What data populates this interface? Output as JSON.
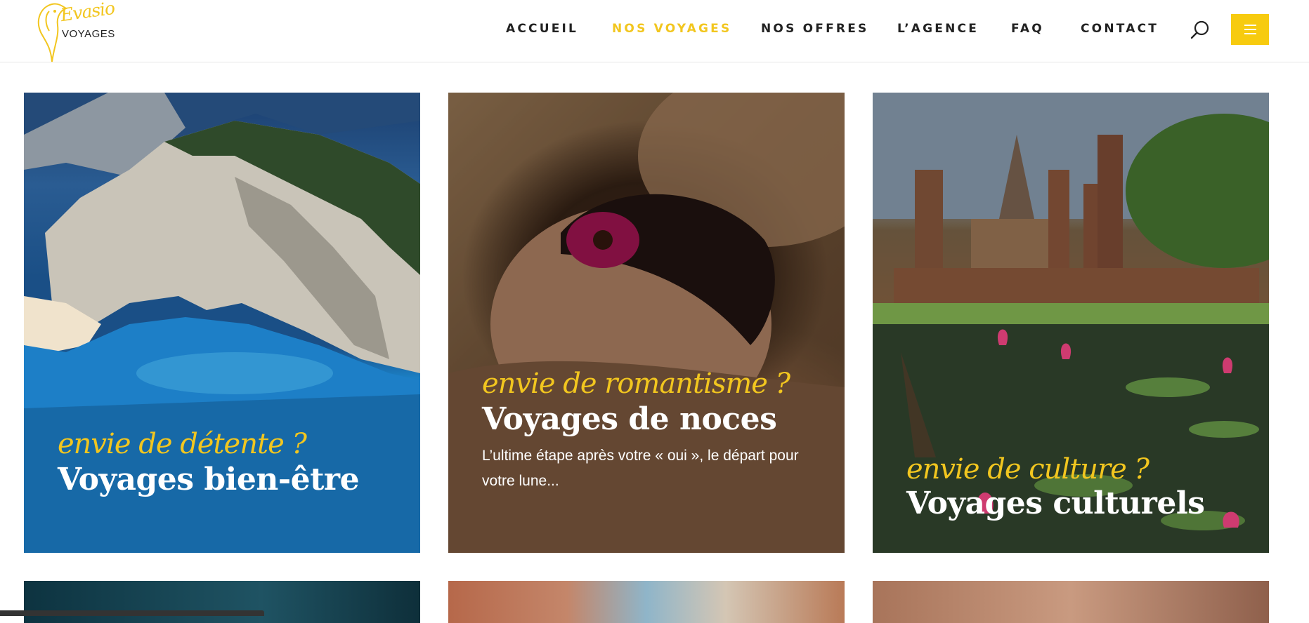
{
  "logo": {
    "script_text": "Evasio",
    "word": "VOYAGES"
  },
  "nav": {
    "items": [
      {
        "label": "ACCUEIL",
        "active": false
      },
      {
        "label": "NOS VOYAGES",
        "active": true
      },
      {
        "label": "NOS OFFRES",
        "active": false
      },
      {
        "label": "L’AGENCE",
        "active": false
      },
      {
        "label": "FAQ",
        "active": false
      },
      {
        "label": "CONTACT",
        "active": false
      }
    ],
    "search_icon": "search-icon",
    "menu_icon": "hamburger-icon"
  },
  "colors": {
    "accent": "#f2c61f",
    "menu_button": "#f7cb0f",
    "text_dark": "#222222"
  },
  "cards": [
    {
      "tag": "envie de détente ?",
      "title": "Voyages bien-être"
    },
    {
      "tag": "envie de romantisme ?",
      "title": "Voyages de noces",
      "description": "L’ultime étape après votre « oui », le départ pour votre lune..."
    },
    {
      "tag": "envie de culture ?",
      "title": "Voyages culturels"
    }
  ]
}
